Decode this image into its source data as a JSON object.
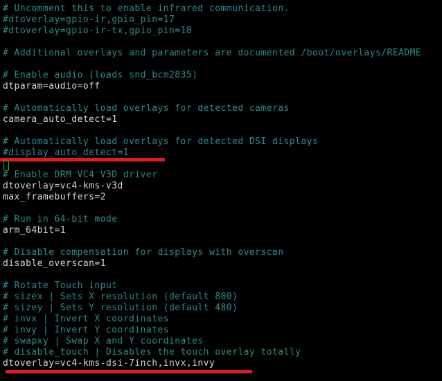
{
  "terminal": {
    "background_color": "#000000",
    "comment_color": "#2e8b8b",
    "code_color": "#d8d8d8",
    "cursor_color": "#23c423",
    "annotation_color": "#d52020",
    "file_lines": [
      {
        "text": "# Uncomment this to enable infrared communication.",
        "kind": "comment"
      },
      {
        "text": "#dtoverlay=gpio-ir,gpio_pin=17",
        "kind": "comment"
      },
      {
        "text": "#dtoverlay=gpio-ir-tx,gpio_pin=18",
        "kind": "comment"
      },
      {
        "text": "",
        "kind": "blank"
      },
      {
        "text": "# Additional overlays and parameters are documented /boot/overlays/README",
        "kind": "comment"
      },
      {
        "text": "",
        "kind": "blank"
      },
      {
        "text": "# Enable audio (loads snd_bcm2835)",
        "kind": "comment"
      },
      {
        "text": "dtparam=audio=off",
        "kind": "code"
      },
      {
        "text": "",
        "kind": "blank"
      },
      {
        "text": "# Automatically load overlays for detected cameras",
        "kind": "comment"
      },
      {
        "text": "camera_auto_detect=1",
        "kind": "code"
      },
      {
        "text": "",
        "kind": "blank"
      },
      {
        "text": "# Automatically load overlays for detected DSI displays",
        "kind": "comment"
      },
      {
        "text": "#display_auto_detect=1",
        "kind": "comment"
      },
      {
        "text": "",
        "kind": "blank"
      },
      {
        "text": "# Enable DRM VC4 V3D driver",
        "kind": "comment"
      },
      {
        "text": "dtoverlay=vc4-kms-v3d",
        "kind": "code"
      },
      {
        "text": "max_framebuffers=2",
        "kind": "code"
      },
      {
        "text": "",
        "kind": "blank"
      },
      {
        "text": "# Run in 64-bit mode",
        "kind": "comment"
      },
      {
        "text": "arm_64bit=1",
        "kind": "code"
      },
      {
        "text": "",
        "kind": "blank"
      },
      {
        "text": "# Disable compensation for displays with overscan",
        "kind": "comment"
      },
      {
        "text": "disable_overscan=1",
        "kind": "code"
      },
      {
        "text": "",
        "kind": "blank"
      },
      {
        "text": "# Rotate Touch input",
        "kind": "comment"
      },
      {
        "text": "# sizex | Sets X resolution (default 800)",
        "kind": "comment"
      },
      {
        "text": "# sizey | Sets Y resolution (default 480)",
        "kind": "comment"
      },
      {
        "text": "# invx | Invert X coordinates",
        "kind": "comment"
      },
      {
        "text": "# invy | Invert Y coordinates",
        "kind": "comment"
      },
      {
        "text": "# swapxy | Swap X and Y coordinates",
        "kind": "comment"
      },
      {
        "text": "# disable_touch | Disables the touch overlay totally",
        "kind": "comment"
      },
      {
        "text": "dtoverlay=vc4-kms-dsi-7inch,invx,invy",
        "kind": "code"
      }
    ],
    "annotations": [
      {
        "name": "underline-display-auto-detect",
        "targets_line": "#display_auto_detect=1"
      },
      {
        "name": "underline-dtoverlay-dsi",
        "targets_line": "dtoverlay=vc4-kms-dsi-7inch,invx,invy"
      }
    ],
    "cursor": {
      "icon": "text-cursor-block",
      "line_index": 14,
      "column": 0
    }
  }
}
